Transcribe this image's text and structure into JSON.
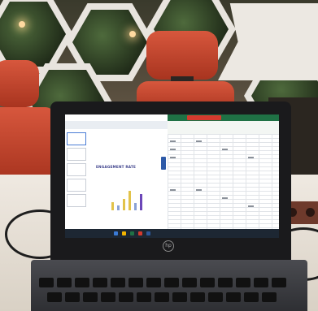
{
  "photo": {
    "scene": "laptop-on-table",
    "screen": {
      "left_app": {
        "slide_title": "ENGAGEMENT RATE",
        "bar_colors": [
          "#e2c34a",
          "#8aa1d6",
          "#e2c34a",
          "#e2c34a",
          "#8aa1d6",
          "#6c47b8"
        ]
      },
      "right_app": {
        "header_accent": "#1f7145",
        "alert_accent": "#d53a2e"
      }
    },
    "laptop_logo": "hp",
    "colors": {
      "chair": "#c44a32",
      "table": "#e9e2d8",
      "wall": "#ece8e2"
    }
  }
}
